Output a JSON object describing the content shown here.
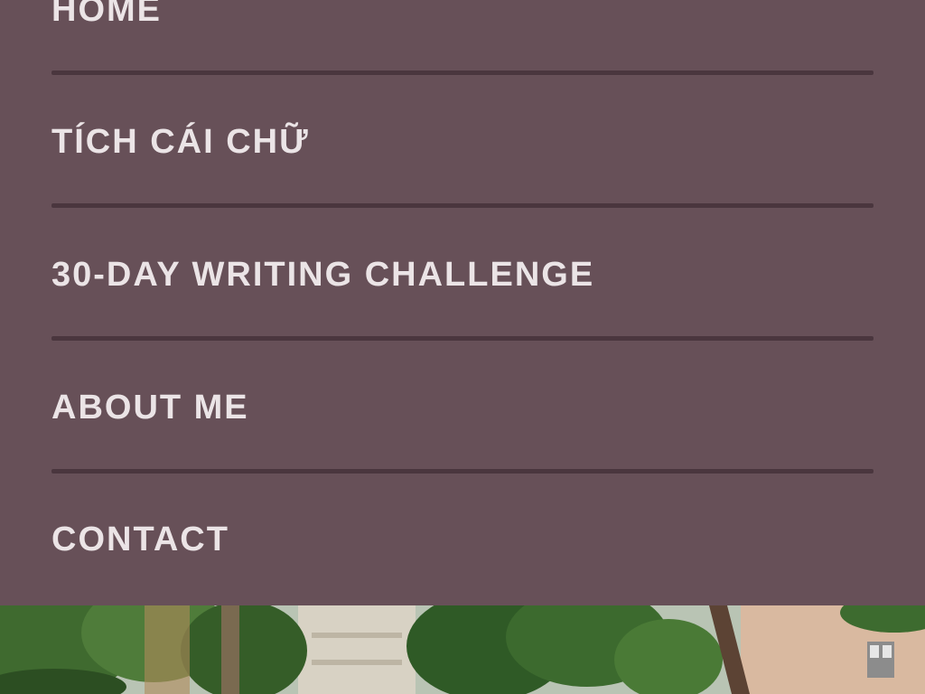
{
  "menu": {
    "items": [
      {
        "label": "HOME"
      },
      {
        "label": "TÍCH CÁI CHỮ"
      },
      {
        "label": "30-DAY WRITING CHALLENGE"
      },
      {
        "label": "ABOUT ME"
      },
      {
        "label": "CONTACT"
      }
    ]
  },
  "colors": {
    "panel_background": "#675058",
    "divider": "#4a363e",
    "text": "#ebe4e6"
  }
}
